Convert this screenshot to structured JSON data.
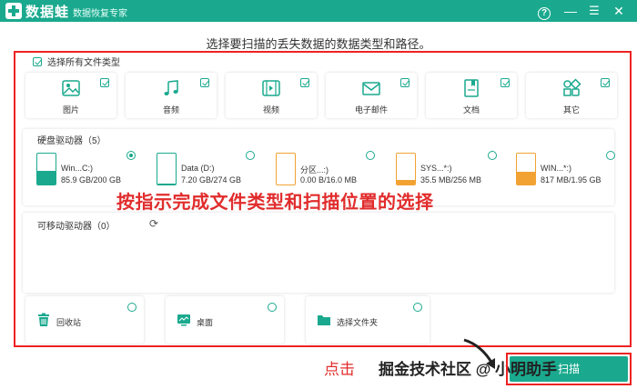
{
  "app": {
    "name": "数据蛙",
    "subtitle": "数据恢复专家",
    "help_symbol": "?",
    "minimize_symbol": "—",
    "menu_symbol": "☰",
    "close_symbol": "✕"
  },
  "instruction": "选择要扫描的丢失数据的数据类型和路径。",
  "select_all": {
    "label": "选择所有文件类型",
    "checked": true
  },
  "file_types": [
    {
      "label": "图片",
      "icon": "image-icon",
      "checked": true
    },
    {
      "label": "音频",
      "icon": "music-icon",
      "checked": true
    },
    {
      "label": "视频",
      "icon": "video-icon",
      "checked": true
    },
    {
      "label": "电子邮件",
      "icon": "email-icon",
      "checked": true
    },
    {
      "label": "文档",
      "icon": "document-icon",
      "checked": true
    },
    {
      "label": "其它",
      "icon": "other-icon",
      "checked": true
    }
  ],
  "hard_drives": {
    "title": "硬盘驱动器（5）",
    "items": [
      {
        "name": "Win...C:)",
        "size": "85.9 GB/200 GB",
        "selected": true,
        "fill": 0.43,
        "color": "#1aa98e"
      },
      {
        "name": "Data (D:)",
        "size": "7.20 GB/274 GB",
        "selected": false,
        "fill": 0.03,
        "color": "#1aa98e"
      },
      {
        "name": "分区...:)",
        "size": "0.00  B/16.0 MB",
        "selected": false,
        "fill": 0.0,
        "color": "#f2a233"
      },
      {
        "name": "SYS...*:)",
        "size": "35.5 MB/256 MB",
        "selected": false,
        "fill": 0.14,
        "color": "#f2a233"
      },
      {
        "name": "WIN...*:)",
        "size": "817 MB/1.95 GB",
        "selected": false,
        "fill": 0.42,
        "color": "#f2a233"
      }
    ]
  },
  "overlay_annotation": "按指示完成文件类型和扫描位置的选择",
  "removable": {
    "title": "可移动驱动器（0）",
    "refresh_icon": "refresh-icon"
  },
  "locations": [
    {
      "label": "回收站",
      "icon": "recycle-bin-icon"
    },
    {
      "label": "桌面",
      "icon": "desktop-icon"
    },
    {
      "label": "选择文件夹",
      "icon": "folder-icon"
    }
  ],
  "bottom": {
    "click_hint": "点击",
    "watermark": "掘金技术社区 @ 小明助手",
    "scan_label": "扫描"
  },
  "colors": {
    "brand": "#1aa98e",
    "annotation_red": "#e12c2c",
    "drive_warning": "#f2a233"
  }
}
